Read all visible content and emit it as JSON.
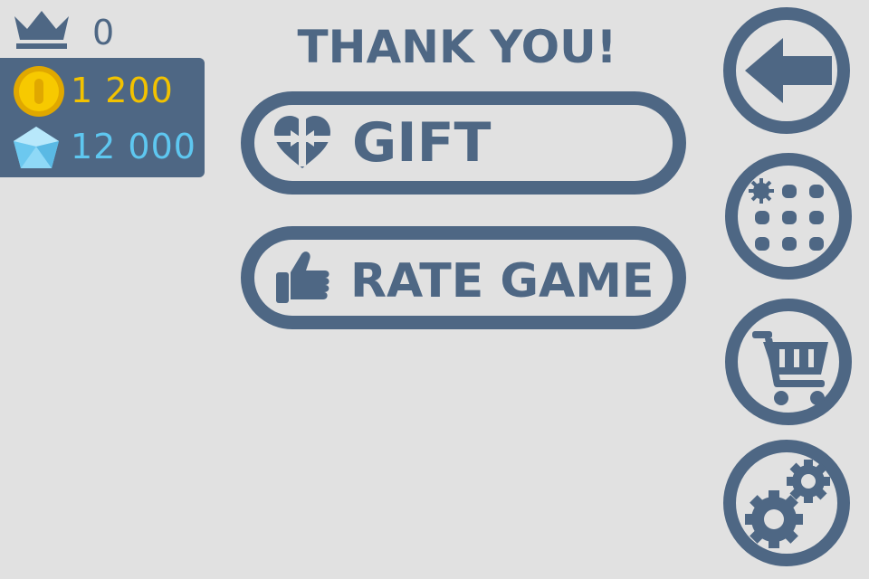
{
  "hud": {
    "best_score": "0",
    "coins": "1 200",
    "gems": "12 000"
  },
  "menu": {
    "title": "THANK YOU!",
    "gift_label": "GIFT",
    "rate_label": "RATE GAME"
  },
  "sidebar": {
    "buttons": [
      "back-arrow-icon",
      "levels-grid-icon",
      "shopping-cart-icon",
      "gears-icon"
    ]
  },
  "colors": {
    "primary": "#4e6784",
    "background": "#e1e1e1",
    "coin": "#f2c200",
    "gem": "#5ec7f0"
  }
}
